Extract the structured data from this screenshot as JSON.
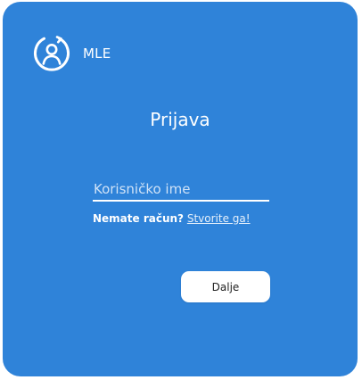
{
  "brand": {
    "name": "MLE",
    "icon": "user-circle-refresh-icon"
  },
  "login": {
    "title": "Prijava",
    "username_placeholder": "Korisničko ime",
    "username_value": "",
    "signup_prompt": "Nemate račun?",
    "signup_link": "Stvorite ga!",
    "next_label": "Dalje"
  },
  "colors": {
    "card_background": "#2f83d9",
    "text": "#ffffff",
    "button_background": "#ffffff",
    "button_text": "#222222"
  }
}
